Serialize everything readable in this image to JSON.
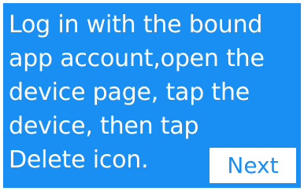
{
  "screen": {
    "instruction_text": "Log in with the bound\napp account,open the\ndevice page, tap the\ndevice, then tap\nDelete icon.",
    "next_label": "Next"
  },
  "colors": {
    "accent": "#1a8ff3",
    "text": "#ffffff",
    "button_background": "#ffffff"
  }
}
